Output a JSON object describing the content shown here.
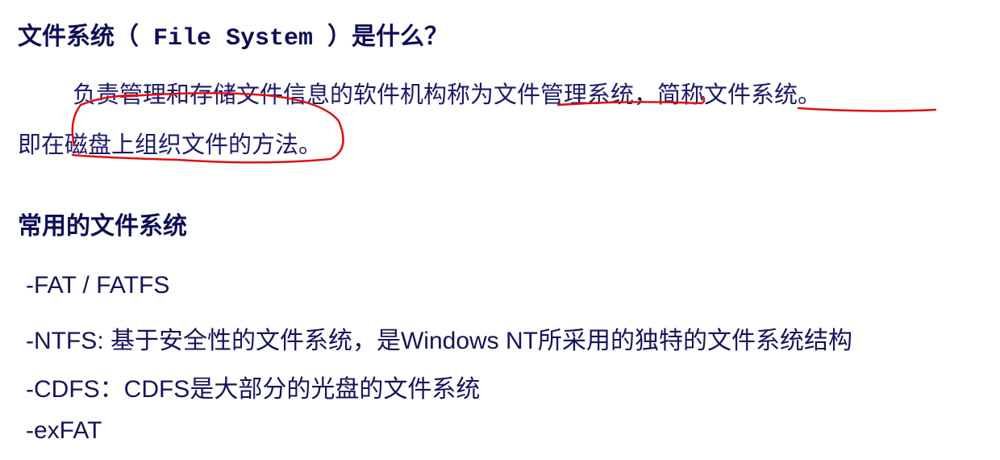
{
  "title": {
    "cn_before": "文件系统（",
    "en": " File System ",
    "cn_after": "）是什么？"
  },
  "paragraph": {
    "line1": "负责管理和存储文件信息的软件机构称为文件管理系统，简称文件系统。",
    "line2": "即在磁盘上组织文件的方法。"
  },
  "section_heading": "常用的文件系统",
  "list": [
    "-FAT / FATFS",
    "-NTFS: 基于安全性的文件系统，是Windows NT所采用的独特的文件系统结构",
    "-CDFS：CDFS是大部分的光盘的文件系统",
    "-exFAT"
  ],
  "annotation_color": "#e01010"
}
